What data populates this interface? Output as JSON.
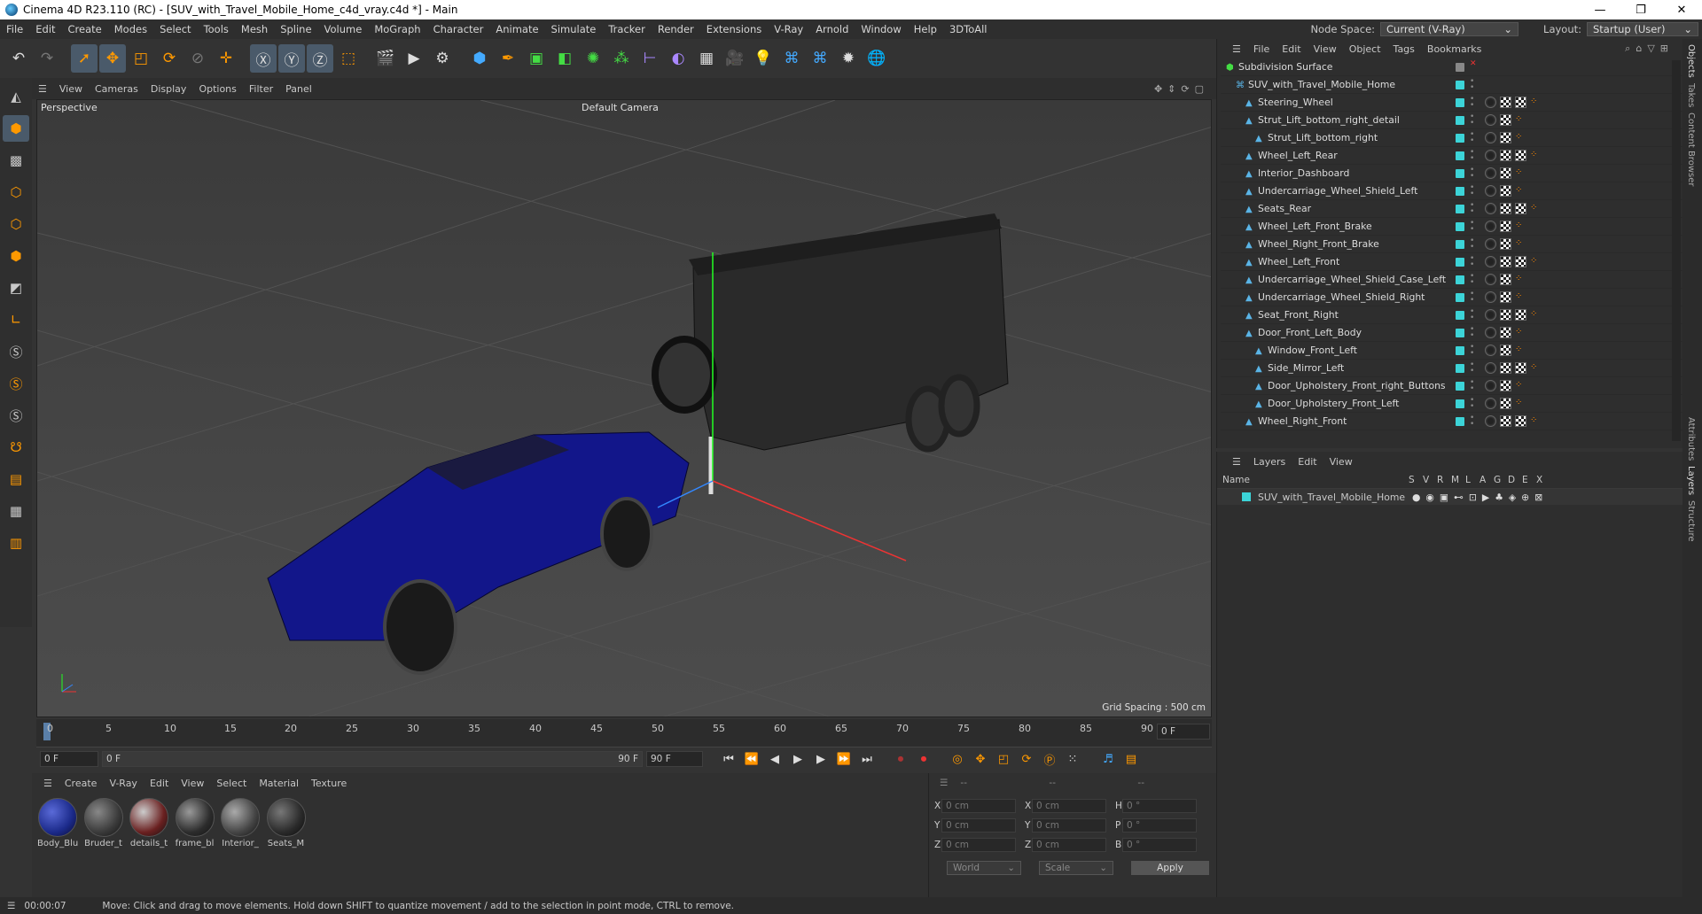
{
  "window": {
    "title": "Cinema 4D R23.110 (RC) - [SUV_with_Travel_Mobile_Home_c4d_vray.c4d *] - Main"
  },
  "menubar": {
    "items": [
      "File",
      "Edit",
      "Create",
      "Modes",
      "Select",
      "Tools",
      "Mesh",
      "Spline",
      "Volume",
      "MoGraph",
      "Character",
      "Animate",
      "Simulate",
      "Tracker",
      "Render",
      "Extensions",
      "V-Ray",
      "Arnold",
      "Window",
      "Help",
      "3DToAll"
    ],
    "node_space_label": "Node Space:",
    "node_space_value": "Current (V-Ray)",
    "layout_label": "Layout:",
    "layout_value": "Startup (User)"
  },
  "viewport": {
    "menu": [
      "View",
      "Cameras",
      "Display",
      "Options",
      "Filter",
      "Panel"
    ],
    "label": "Perspective",
    "camera": "Default Camera",
    "grid_spacing": "Grid Spacing : 500 cm"
  },
  "timeline": {
    "ticks": [
      "0",
      "5",
      "10",
      "15",
      "20",
      "25",
      "30",
      "35",
      "40",
      "45",
      "50",
      "55",
      "60",
      "65",
      "70",
      "75",
      "80",
      "85",
      "90"
    ],
    "current_frame": "0 F"
  },
  "transport": {
    "start": "0 F",
    "range_start": "0 F",
    "range_end": "90 F",
    "end": "90 F"
  },
  "materials": {
    "menu": [
      "Create",
      "V-Ray",
      "Edit",
      "View",
      "Select",
      "Material",
      "Texture"
    ],
    "items": [
      {
        "label": "Body_Blu",
        "color": "#1b2a8a"
      },
      {
        "label": "Bruder_t",
        "color": "#3a3a3a"
      },
      {
        "label": "details_t",
        "color": "#6a2020"
      },
      {
        "label": "frame_bl",
        "color": "#2c2c2c"
      },
      {
        "label": "Interior_",
        "color": "#454545"
      },
      {
        "label": "Seats_M",
        "color": "#2a2a2a"
      }
    ]
  },
  "coords": {
    "header": [
      "--",
      "--",
      "--"
    ],
    "rows": [
      {
        "a": "X",
        "av": "0 cm",
        "b": "X",
        "bv": "0 cm",
        "c": "H",
        "cv": "0 °"
      },
      {
        "a": "Y",
        "av": "0 cm",
        "b": "Y",
        "bv": "0 cm",
        "c": "P",
        "cv": "0 °"
      },
      {
        "a": "Z",
        "av": "0 cm",
        "b": "Z",
        "bv": "0 cm",
        "c": "B",
        "cv": "0 °"
      }
    ],
    "world": "World",
    "scale": "Scale",
    "apply": "Apply"
  },
  "objects": {
    "menu": [
      "File",
      "Edit",
      "View",
      "Object",
      "Tags",
      "Bookmarks"
    ],
    "rows": [
      {
        "name": "Subdivision Surface",
        "indent": 0
      },
      {
        "name": "SUV_with_Travel_Mobile_Home",
        "indent": 1
      },
      {
        "name": "Steering_Wheel",
        "indent": 2
      },
      {
        "name": "Strut_Lift_bottom_right_detail",
        "indent": 2
      },
      {
        "name": "Strut_Lift_bottom_right",
        "indent": 3
      },
      {
        "name": "Wheel_Left_Rear",
        "indent": 2
      },
      {
        "name": "Interior_Dashboard",
        "indent": 2
      },
      {
        "name": "Undercarriage_Wheel_Shield_Left",
        "indent": 2
      },
      {
        "name": "Seats_Rear",
        "indent": 2
      },
      {
        "name": "Wheel_Left_Front_Brake",
        "indent": 2
      },
      {
        "name": "Wheel_Right_Front_Brake",
        "indent": 2
      },
      {
        "name": "Wheel_Left_Front",
        "indent": 2
      },
      {
        "name": "Undercarriage_Wheel_Shield_Case_Left",
        "indent": 2
      },
      {
        "name": "Undercarriage_Wheel_Shield_Right",
        "indent": 2
      },
      {
        "name": "Seat_Front_Right",
        "indent": 2
      },
      {
        "name": "Door_Front_Left_Body",
        "indent": 2
      },
      {
        "name": "Window_Front_Left",
        "indent": 3
      },
      {
        "name": "Side_Mirror_Left",
        "indent": 3
      },
      {
        "name": "Door_Upholstery_Front_right_Buttons",
        "indent": 3
      },
      {
        "name": "Door_Upholstery_Front_Left",
        "indent": 3
      },
      {
        "name": "Wheel_Right_Front",
        "indent": 2
      }
    ]
  },
  "layers": {
    "menu": [
      "Layers",
      "Edit",
      "View"
    ],
    "name_header": "Name",
    "flags": [
      "S",
      "V",
      "R",
      "M",
      "L",
      "A",
      "G",
      "D",
      "E",
      "X"
    ],
    "row": "SUV_with_Travel_Mobile_Home"
  },
  "right_tabs": [
    "Objects",
    "Takes",
    "Content Browser",
    "Attributes",
    "Layers",
    "Structure"
  ],
  "status": {
    "time": "00:00:07",
    "message": "Move: Click and drag to move elements. Hold down SHIFT to quantize movement / add to the selection in point mode, CTRL to remove."
  }
}
